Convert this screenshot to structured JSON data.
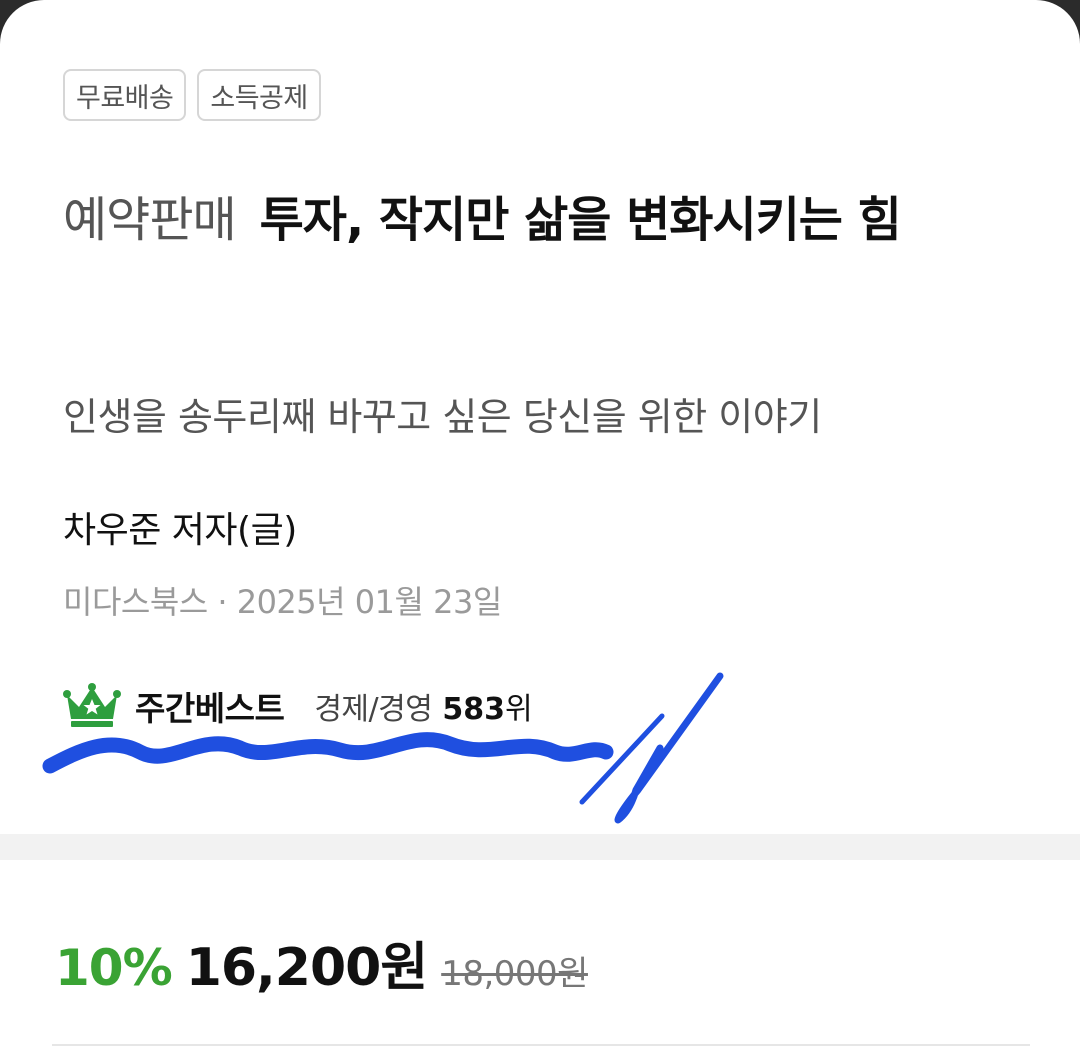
{
  "tags": [
    "무료배송",
    "소득공제"
  ],
  "book": {
    "pre_label": "예약판매",
    "title": "투자, 작지만 삶을 변화시키는 힘",
    "subtitle": "인생을 송두리째 바꾸고 싶은 당신을 위한 이야기",
    "author": "차우준 저자(글)",
    "publisher_date": "미다스북스 · 2025년 01월 23일"
  },
  "bestseller": {
    "label": "주간베스트",
    "category": "경제/경영",
    "rank_number": "583",
    "rank_suffix": "위",
    "icon": "crown-icon",
    "icon_color": "#2e9e3e"
  },
  "price": {
    "discount": "10%",
    "sale_price": "16,200원",
    "original_price": "18,000원",
    "discount_color": "#3aa334"
  },
  "annotation": {
    "color": "#1f4fe0"
  }
}
